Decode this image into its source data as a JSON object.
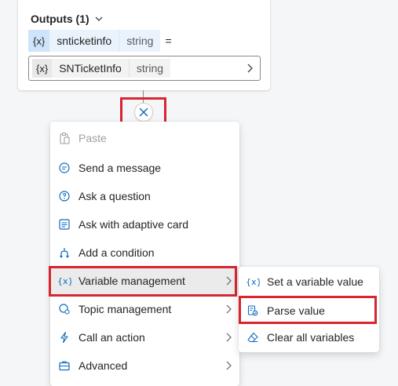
{
  "outputs": {
    "header": "Outputs (1)",
    "variable": {
      "badge": "{x}",
      "name": "snticketinfo",
      "type": "string",
      "operator": "="
    },
    "value": {
      "badge": "{x}",
      "name": "SNTicketInfo",
      "type": "string"
    }
  },
  "menu": {
    "items": [
      {
        "label": "Paste",
        "icon": "paste-icon",
        "disabled": true
      },
      {
        "label": "Send a message",
        "icon": "message-icon"
      },
      {
        "label": "Ask a question",
        "icon": "question-icon"
      },
      {
        "label": "Ask with adaptive card",
        "icon": "adaptive-card-icon"
      },
      {
        "label": "Add a condition",
        "icon": "condition-icon"
      },
      {
        "label": "Variable management",
        "icon": "variable-icon",
        "submenu": true,
        "active": true
      },
      {
        "label": "Topic management",
        "icon": "topic-icon",
        "submenu": true
      },
      {
        "label": "Call an action",
        "icon": "action-icon",
        "submenu": true
      },
      {
        "label": "Advanced",
        "icon": "advanced-icon",
        "submenu": true
      }
    ]
  },
  "submenu": {
    "items": [
      {
        "label": "Set a variable value",
        "icon": "set-variable-icon"
      },
      {
        "label": "Parse value",
        "icon": "parse-value-icon"
      },
      {
        "label": "Clear all variables",
        "icon": "eraser-icon"
      }
    ]
  },
  "colors": {
    "highlight": "#d7262f",
    "accent": "#0f6cbd",
    "variable_chip": "#cfe4fa"
  }
}
